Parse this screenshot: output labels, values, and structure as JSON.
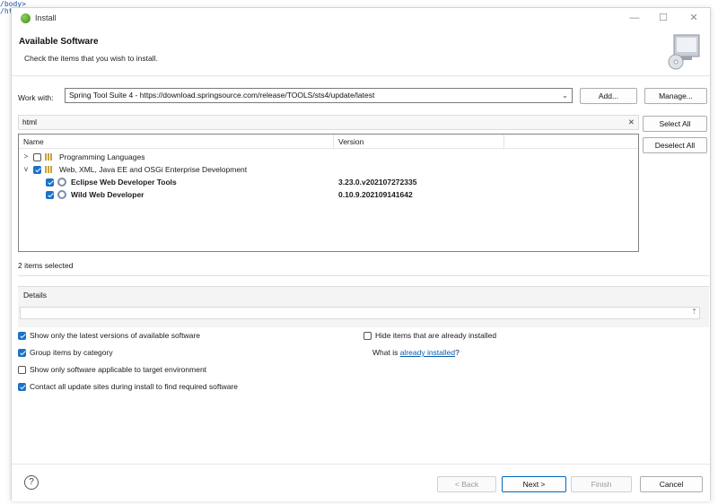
{
  "background_code": [
    "/body>",
    "/html>"
  ],
  "window": {
    "title": "Install",
    "controls": {
      "minimize": "—",
      "maximize": "☐",
      "close": "✕"
    }
  },
  "header": {
    "title": "Available Software",
    "description": "Check the items that you wish to install."
  },
  "work_with": {
    "label": "Work with:",
    "value": "Spring Tool Suite 4 - https://download.springsource.com/release/TOOLS/sts4/update/latest",
    "add_label": "Add...",
    "manage_label": "Manage..."
  },
  "filter": {
    "value": "html",
    "clear_icon": "✕"
  },
  "side_buttons": {
    "select_all": "Select All",
    "deselect_all": "Deselect All"
  },
  "tree": {
    "columns": [
      "Name",
      "Version"
    ],
    "rows": [
      {
        "name": "Programming Languages",
        "version": "",
        "checked": false,
        "expanded": false,
        "twisty": ">"
      },
      {
        "name": "Web, XML, Java EE and OSGi Enterprise Development",
        "version": "",
        "checked": true,
        "expanded": true,
        "twisty": "v"
      },
      {
        "name": "Eclipse Web Developer Tools",
        "version": "3.23.0.v202107272335",
        "checked": true
      },
      {
        "name": "Wild Web Developer",
        "version": "0.10.9.202109141642",
        "checked": true
      }
    ]
  },
  "status": "2 items selected",
  "details": {
    "label": "Details",
    "scroll_glyph": "⇡"
  },
  "options": {
    "latest_versions": {
      "label": "Show only the latest versions of available software",
      "checked": true
    },
    "hide_installed": {
      "label": "Hide items that are already installed",
      "checked": false
    },
    "group_by_category": {
      "label": "Group items by category",
      "checked": true
    },
    "what_is": {
      "prefix": "What is ",
      "link": "already installed",
      "suffix": "?"
    },
    "target_env": {
      "label": "Show only software applicable to target environment",
      "checked": false
    },
    "contact_sites": {
      "label": "Contact all update sites during install to find required software",
      "checked": true
    }
  },
  "footer": {
    "help_glyph": "?",
    "back": "< Back",
    "next": "Next >",
    "finish": "Finish",
    "cancel": "Cancel"
  },
  "colors": {
    "accent": "#1a73c9",
    "link": "#0b5cad"
  }
}
